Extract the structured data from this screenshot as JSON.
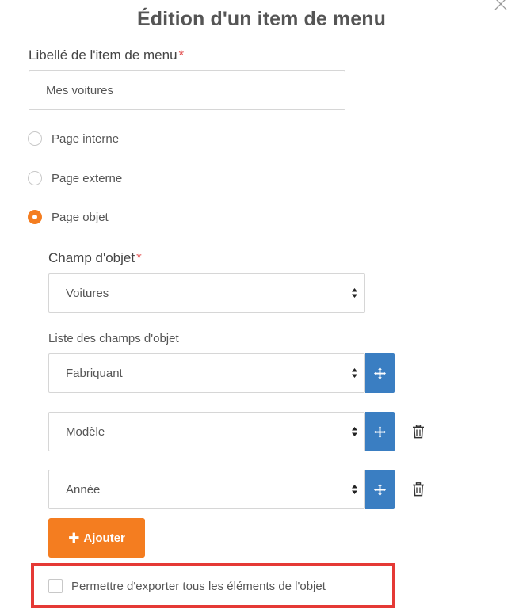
{
  "dialog": {
    "title": "Édition d'un item de menu",
    "close_icon": "close-icon"
  },
  "menu_item": {
    "label": "Libellé de l'item de menu",
    "required_mark": "*",
    "value": "Mes voitures"
  },
  "page_type": {
    "options": [
      {
        "label": "Page interne",
        "checked": false
      },
      {
        "label": "Page externe",
        "checked": false
      },
      {
        "label": "Page objet",
        "checked": true
      }
    ]
  },
  "object_field": {
    "label": "Champ d'objet",
    "required_mark": "*",
    "value": "Voitures"
  },
  "field_list": {
    "label": "Liste des champs d'objet",
    "items": [
      {
        "value": "Fabriquant",
        "move_icon": "move-icon",
        "deletable": false
      },
      {
        "value": "Modèle",
        "move_icon": "move-icon",
        "deletable": true,
        "delete_icon": "trash-icon"
      },
      {
        "value": "Année",
        "move_icon": "move-icon",
        "deletable": true,
        "delete_icon": "trash-icon"
      }
    ],
    "add_button": {
      "icon": "plus-icon",
      "icon_glyph": "✚",
      "label": "Ajouter"
    }
  },
  "export_option": {
    "label": "Permettre d'exporter tous les éléments de l'objet",
    "checked": false,
    "highlighted": true
  },
  "colors": {
    "accent_orange": "#f47d20",
    "move_blue": "#3a7ec2",
    "highlight_red": "#e53935",
    "required_red": "#e24b4b"
  }
}
